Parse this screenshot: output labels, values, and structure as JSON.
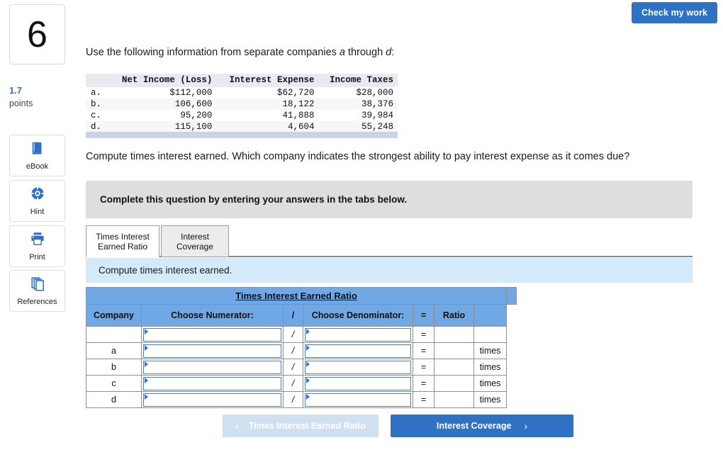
{
  "header": {
    "check_my_work_label": "Check my work"
  },
  "sidebar": {
    "question_number": "6",
    "points_value": "1.7",
    "points_label": "points",
    "items": [
      {
        "label": "eBook",
        "icon": "book-icon"
      },
      {
        "label": "Hint",
        "icon": "lifebuoy-icon"
      },
      {
        "label": "Print",
        "icon": "printer-icon"
      },
      {
        "label": "References",
        "icon": "copy-pages-icon"
      }
    ]
  },
  "main": {
    "intro_prefix": "Use the following information from separate companies ",
    "intro_em1": "a",
    "intro_mid": " through ",
    "intro_em2": "d",
    "intro_suffix": ":",
    "question_prompt": "Compute times interest earned. Which company indicates the strongest ability to pay interest expense as it comes due?",
    "complete_banner": "Complete this question by entering your answers in the tabs below.",
    "sub_instruction": "Compute times interest earned."
  },
  "given_table": {
    "columns": [
      "",
      "Net Income (Loss)",
      "Interest Expense",
      "Income Taxes"
    ],
    "rows": [
      {
        "label": "a.",
        "net_income": "$112,000",
        "interest_expense": "$62,720",
        "income_taxes": "$28,000"
      },
      {
        "label": "b.",
        "net_income": "106,600",
        "interest_expense": "18,122",
        "income_taxes": "38,376"
      },
      {
        "label": "c.",
        "net_income": "95,200",
        "interest_expense": "41,888",
        "income_taxes": "39,984"
      },
      {
        "label": "d.",
        "net_income": "115,100",
        "interest_expense": "4,604",
        "income_taxes": "55,248"
      }
    ]
  },
  "tabs": [
    {
      "line1": "Times Interest",
      "line2": "Earned Ratio",
      "active": true
    },
    {
      "line1": "Interest",
      "line2": "Coverage",
      "active": false
    }
  ],
  "answer_table": {
    "title": "Times Interest Earned Ratio",
    "headers": {
      "company": "Company",
      "numerator": "Choose Numerator:",
      "slash": "/",
      "denominator": "Choose Denominator:",
      "equals": "=",
      "ratio": "Ratio"
    },
    "rows": [
      {
        "company": "",
        "numerator": "",
        "slash": "/",
        "denominator": "",
        "equals": "=",
        "ratio": "",
        "unit": ""
      },
      {
        "company": "a",
        "numerator": "",
        "slash": "/",
        "denominator": "",
        "equals": "=",
        "ratio": "",
        "unit": "times"
      },
      {
        "company": "b",
        "numerator": "",
        "slash": "/",
        "denominator": "",
        "equals": "=",
        "ratio": "",
        "unit": "times"
      },
      {
        "company": "c",
        "numerator": "",
        "slash": "/",
        "denominator": "",
        "equals": "=",
        "ratio": "",
        "unit": "times"
      },
      {
        "company": "d",
        "numerator": "",
        "slash": "/",
        "denominator": "",
        "equals": "=",
        "ratio": "",
        "unit": "times"
      }
    ]
  },
  "nav": {
    "prev_label": "Times Interest Earned Ratio",
    "prev_chevron": "‹",
    "next_label": "Interest Coverage",
    "next_chevron": "›"
  },
  "colors": {
    "primary_blue": "#2f72c4",
    "table_header_blue": "#6fa8e4",
    "sub_instruction_blue": "#d4eaf8",
    "banner_gray": "#dedede",
    "prev_disabled": "#cfe0f1"
  }
}
